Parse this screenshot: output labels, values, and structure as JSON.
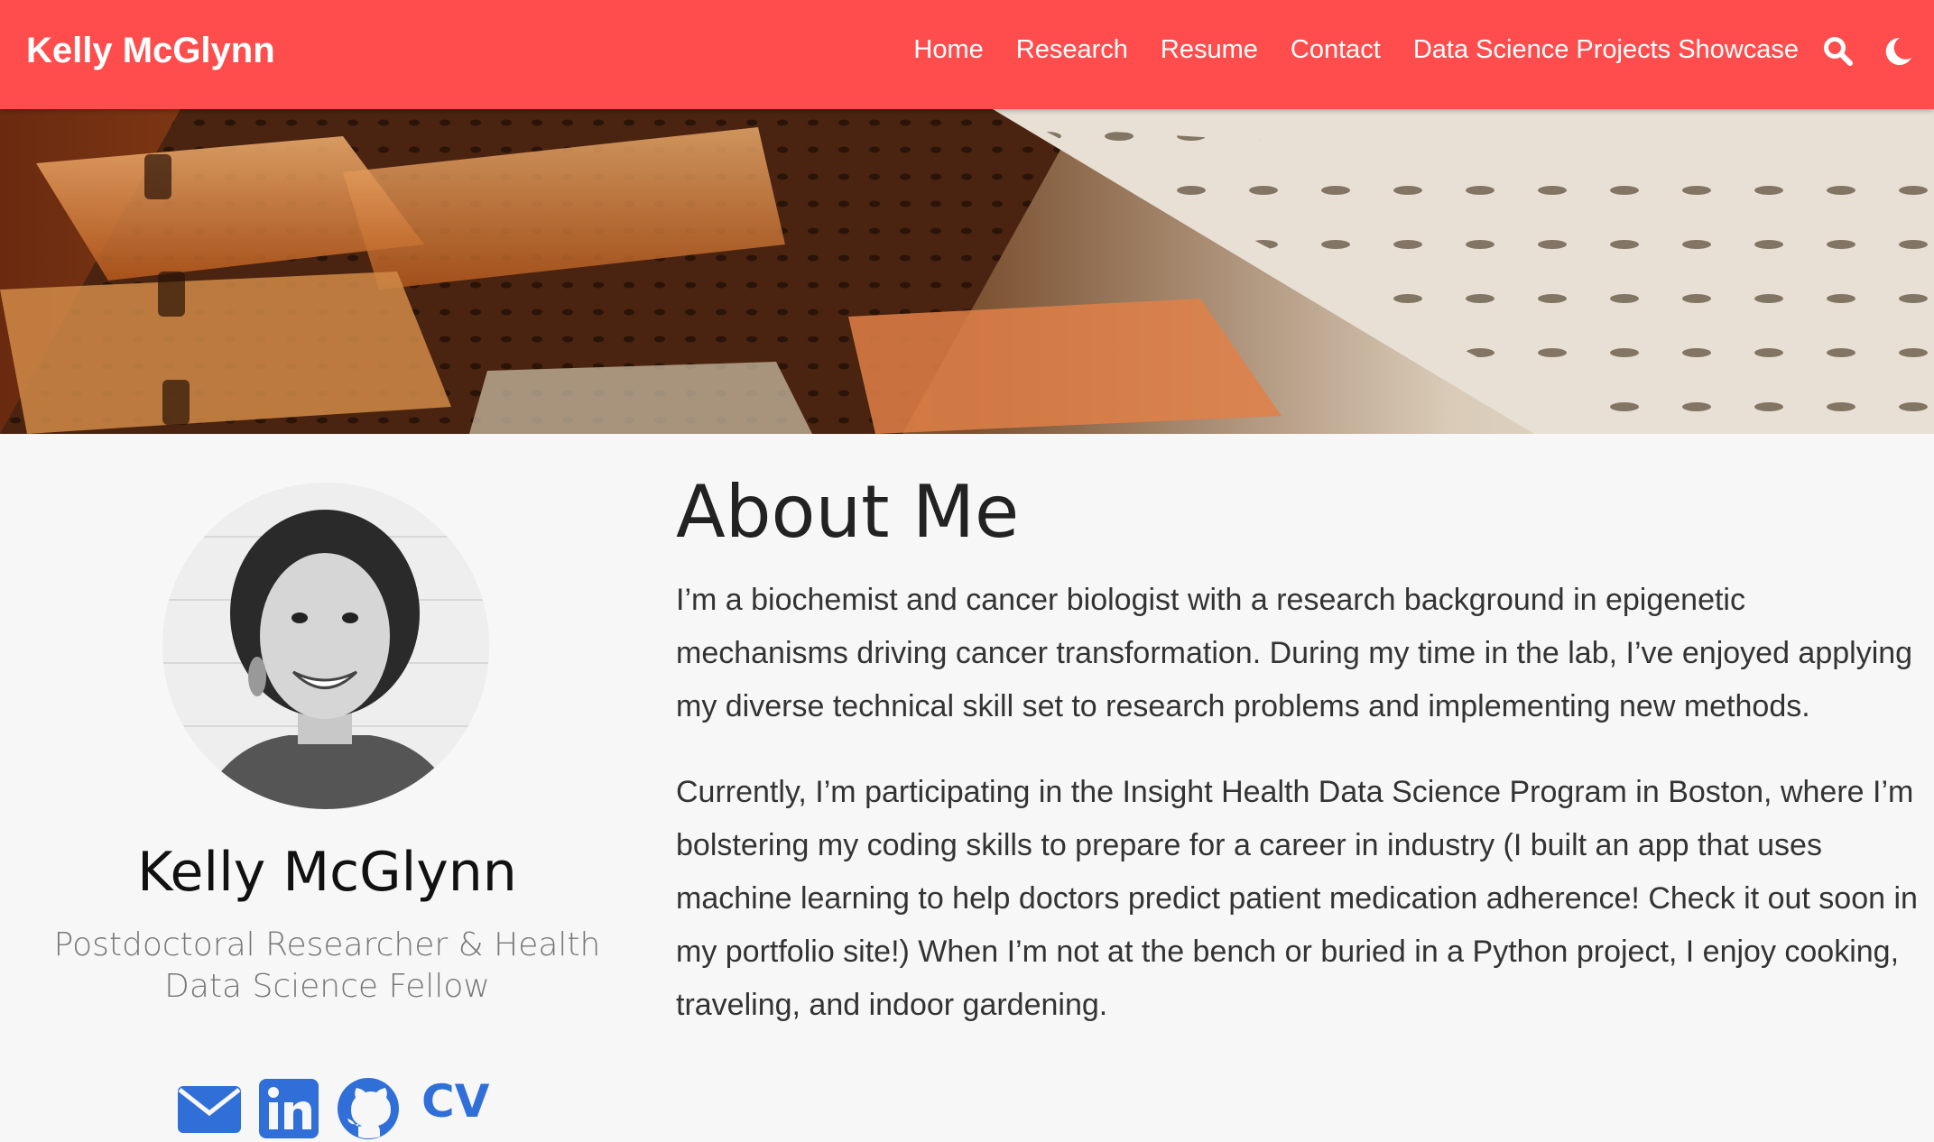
{
  "navbar": {
    "brand": "Kelly McGlynn",
    "links": [
      "Home",
      "Research",
      "Resume",
      "Contact",
      "Data Science Projects Showcase"
    ],
    "icons": [
      "search-icon",
      "moon-icon"
    ],
    "background_color": "#ff4d4d"
  },
  "hero": {
    "image": "lab-plates-banner"
  },
  "profile": {
    "avatar": "profile-photo",
    "name": "Kelly McGlynn",
    "title": "Postdoctoral Researcher & Health Data Science Fellow",
    "social_icons": [
      "envelope-icon",
      "linkedin-icon",
      "github-icon"
    ],
    "cv_label": "CV",
    "accent_color": "#2f6fd7"
  },
  "about": {
    "heading": "About Me",
    "paragraphs": [
      "I’m a biochemist and cancer biologist with a research background in epigenetic mechanisms driving cancer transformation. During my time in the lab, I’ve enjoyed applying my diverse technical skill set to research problems and implementing new methods.",
      "Currently, I’m participating in the Insight Health Data Science Program in Boston, where I’m bolstering my coding skills to prepare for a career in industry (I built an app that uses machine learning to help doctors predict patient medication adherence! Check it out soon in my portfolio site!) When I’m not at the bench or buried in a Python project, I enjoy cooking, traveling, and indoor gardening."
    ]
  }
}
